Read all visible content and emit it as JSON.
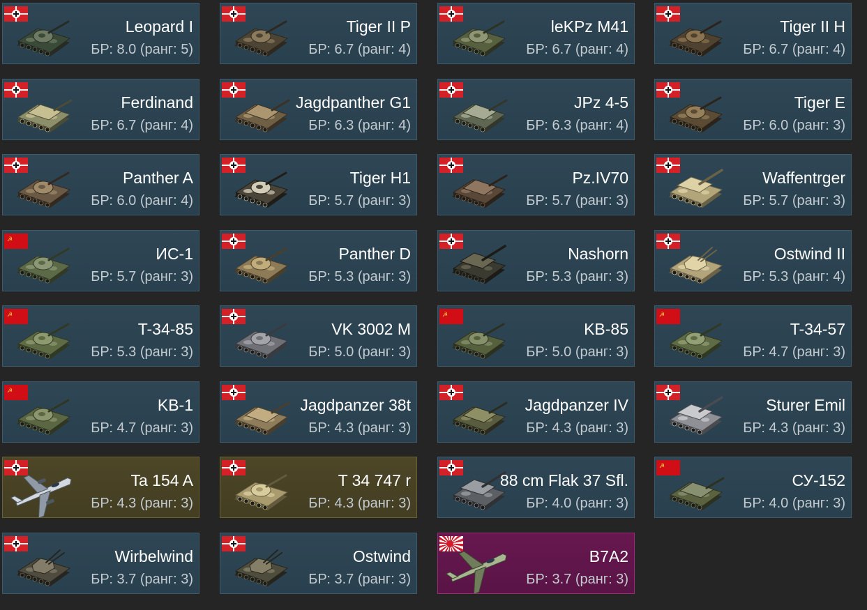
{
  "br_prefix": "БР:",
  "rank_prefix": "ранг:",
  "units": [
    {
      "name": "Leopard I",
      "br": "8.0",
      "rank": "5",
      "nation": "de",
      "kind": "tank",
      "tint": "premium-none",
      "camo": [
        "#3a4a38",
        "#6e7a64",
        "#262b24"
      ]
    },
    {
      "name": "Tiger II P",
      "br": "6.7",
      "rank": "4",
      "nation": "de",
      "kind": "tank",
      "tint": "none",
      "camo": [
        "#4d4434",
        "#8a7b5d",
        "#2d2820"
      ]
    },
    {
      "name": "leKPz M41",
      "br": "6.7",
      "rank": "4",
      "nation": "de",
      "kind": "tank",
      "tint": "none",
      "camo": [
        "#56603f",
        "#8e9675",
        "#2d3223"
      ]
    },
    {
      "name": "Tiger II H",
      "br": "6.7",
      "rank": "4",
      "nation": "de",
      "kind": "tank",
      "tint": "none",
      "camo": [
        "#4f4230",
        "#8a7350",
        "#2c241b"
      ]
    },
    {
      "name": "Ferdinand",
      "br": "6.7",
      "rank": "4",
      "nation": "de",
      "kind": "td",
      "tint": "none",
      "camo": [
        "#8c8f6a",
        "#c7bf91",
        "#4b4c38"
      ]
    },
    {
      "name": "Jagdpanther G1",
      "br": "6.3",
      "rank": "4",
      "nation": "de",
      "kind": "td",
      "tint": "none",
      "camo": [
        "#6f5f45",
        "#ab9670",
        "#3a3226"
      ]
    },
    {
      "name": "JPz 4-5",
      "br": "6.3",
      "rank": "4",
      "nation": "de",
      "kind": "td",
      "tint": "none",
      "camo": [
        "#5f6652",
        "#a6ab94",
        "#33372b"
      ]
    },
    {
      "name": "Tiger E",
      "br": "6.0",
      "rank": "3",
      "nation": "de",
      "kind": "tank",
      "tint": "none",
      "camo": [
        "#5b4b34",
        "#95805b",
        "#2c241a"
      ]
    },
    {
      "name": "Panther A",
      "br": "6.0",
      "rank": "4",
      "nation": "de",
      "kind": "tank",
      "tint": "none",
      "camo": [
        "#6a5944",
        "#9f8b6a",
        "#34291f"
      ]
    },
    {
      "name": "Tiger H1",
      "br": "5.7",
      "rank": "3",
      "nation": "de",
      "kind": "tank",
      "tint": "none",
      "camo": [
        "#4a4538",
        "#d1cbb7",
        "#1f1d18"
      ]
    },
    {
      "name": "Pz.IV70",
      "br": "5.7",
      "rank": "3",
      "nation": "de",
      "kind": "td",
      "tint": "none",
      "camo": [
        "#594738",
        "#8e7660",
        "#2b2219"
      ]
    },
    {
      "name": "Waffentrger",
      "br": "5.7",
      "rank": "3",
      "nation": "de",
      "kind": "spg",
      "tint": "none",
      "camo": [
        "#b2a57a",
        "#ddd2a6",
        "#6a6247"
      ]
    },
    {
      "name": "ИС-1",
      "br": "5.7",
      "rank": "3",
      "nation": "su",
      "kind": "tank",
      "tint": "none",
      "camo": [
        "#5d6a48",
        "#8c9875",
        "#323a26"
      ]
    },
    {
      "name": "Panther D",
      "br": "5.3",
      "rank": "3",
      "nation": "de",
      "kind": "tank",
      "tint": "none",
      "camo": [
        "#8c7b56",
        "#c1ac7c",
        "#4a3f2b"
      ]
    },
    {
      "name": "Nashorn",
      "br": "5.3",
      "rank": "3",
      "nation": "de",
      "kind": "spg",
      "tint": "none",
      "camo": [
        "#3b3a30",
        "#6a6753",
        "#1c1b16"
      ]
    },
    {
      "name": "Ostwind II",
      "br": "5.3",
      "rank": "4",
      "nation": "de",
      "kind": "aa",
      "tint": "none",
      "camo": [
        "#b3a57b",
        "#e0d4a8",
        "#6c6248"
      ]
    },
    {
      "name": "T-34-85",
      "br": "5.3",
      "rank": "3",
      "nation": "su",
      "kind": "tank",
      "tint": "none",
      "camo": [
        "#5e6b44",
        "#8d9a70",
        "#313922"
      ]
    },
    {
      "name": "VK 3002 M",
      "br": "5.0",
      "rank": "3",
      "nation": "de",
      "kind": "tank",
      "tint": "none",
      "camo": [
        "#6f7177",
        "#a2a4aa",
        "#3a3b3f"
      ]
    },
    {
      "name": "KB-85",
      "br": "5.0",
      "rank": "3",
      "nation": "su",
      "kind": "tank",
      "tint": "none",
      "camo": [
        "#56603c",
        "#86906a",
        "#2b3020"
      ]
    },
    {
      "name": "T-34-57",
      "br": "4.7",
      "rank": "3",
      "nation": "su",
      "kind": "tank",
      "tint": "none",
      "camo": [
        "#5f6b45",
        "#939f74",
        "#313922"
      ]
    },
    {
      "name": "KB-1",
      "br": "4.7",
      "rank": "3",
      "nation": "su",
      "kind": "tank",
      "tint": "none",
      "camo": [
        "#5b6642",
        "#8b966e",
        "#2f3622"
      ]
    },
    {
      "name": "Jagdpanzer 38t",
      "br": "4.3",
      "rank": "3",
      "nation": "de",
      "kind": "td",
      "tint": "none",
      "camo": [
        "#8e7c5a",
        "#c2ad82",
        "#4a3f2c"
      ]
    },
    {
      "name": "Jagdpanzer IV",
      "br": "4.3",
      "rank": "3",
      "nation": "de",
      "kind": "td",
      "tint": "none",
      "camo": [
        "#5a5c3f",
        "#8f8f66",
        "#2b2c1f"
      ]
    },
    {
      "name": "Sturer Emil",
      "br": "4.3",
      "rank": "3",
      "nation": "de",
      "kind": "spg",
      "tint": "none",
      "camo": [
        "#8e9096",
        "#c9cace",
        "#4a4b4f"
      ]
    },
    {
      "name": "Ta 154 A",
      "br": "4.3",
      "rank": "3",
      "nation": "de",
      "kind": "plane-twin",
      "tint": "premium",
      "camo": [
        "#8f9aa6",
        "#d2d8de",
        "#4f5861"
      ]
    },
    {
      "name": "T 34 747 r",
      "br": "4.3",
      "rank": "3",
      "nation": "de",
      "kind": "tank",
      "tint": "premium",
      "camo": [
        "#a99b6d",
        "#d8cc9c",
        "#645b3f"
      ]
    },
    {
      "name": "88 cm Flak 37 Sfl.",
      "br": "4.0",
      "rank": "3",
      "nation": "de",
      "kind": "spg",
      "tint": "none",
      "camo": [
        "#5c5f63",
        "#9a9ea3",
        "#2f3134"
      ]
    },
    {
      "name": "СУ-152",
      "br": "4.0",
      "rank": "3",
      "nation": "su",
      "kind": "td",
      "tint": "none",
      "camo": [
        "#5a6240",
        "#879070",
        "#2d3120"
      ]
    },
    {
      "name": "Wirbelwind",
      "br": "3.7",
      "rank": "3",
      "nation": "de",
      "kind": "aa",
      "tint": "none",
      "camo": [
        "#4f4b3f",
        "#827c69",
        "#27251f"
      ]
    },
    {
      "name": "Ostwind",
      "br": "3.7",
      "rank": "3",
      "nation": "de",
      "kind": "aa",
      "tint": "none",
      "camo": [
        "#4e4c3c",
        "#847f66",
        "#26251d"
      ]
    },
    {
      "name": "B7A2",
      "br": "3.7",
      "rank": "3",
      "nation": "jp",
      "kind": "plane",
      "tint": "squadron",
      "camo": [
        "#6f7d5a",
        "#a9b590",
        "#3a4230"
      ]
    }
  ]
}
